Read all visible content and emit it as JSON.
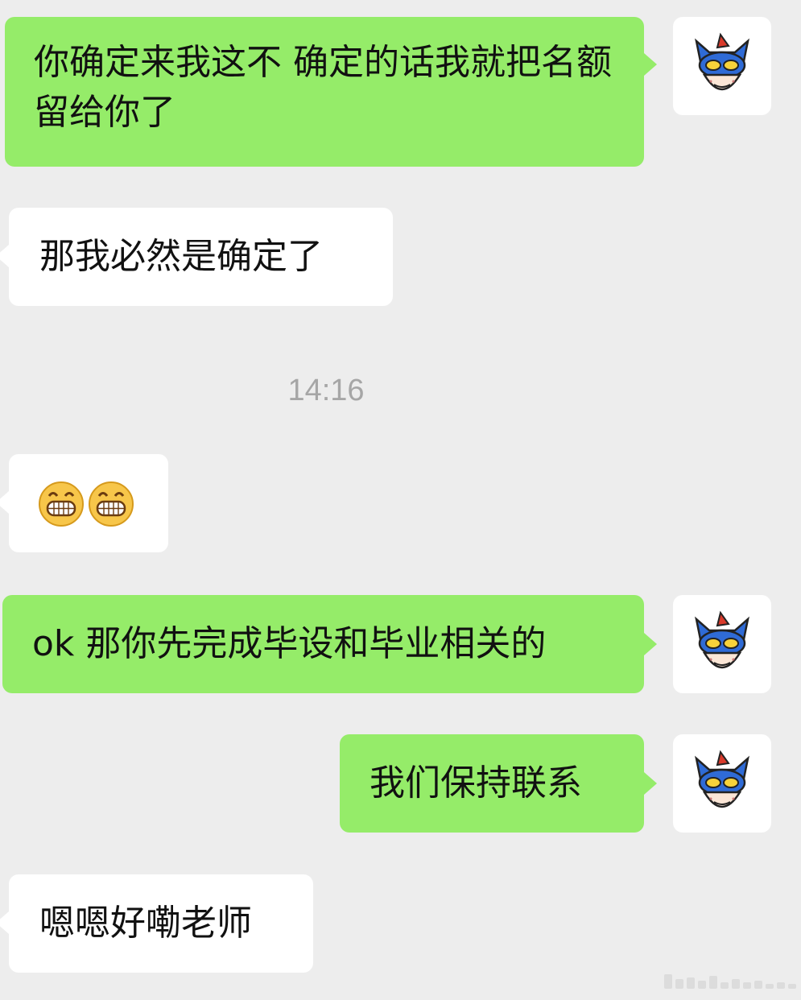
{
  "chat": {
    "messages": [
      {
        "side": "sent",
        "text": "你确定来我这不 确定的话我就把名额留给你了"
      },
      {
        "side": "received",
        "text": "那我必然是确定了"
      },
      {
        "side": "timestamp",
        "text": "14:16"
      },
      {
        "side": "received",
        "emoji": [
          "grinning-face-emoji",
          "grinning-face-emoji"
        ]
      },
      {
        "side": "sent",
        "text": "ok 那你先完成毕设和毕业相关的"
      },
      {
        "side": "sent",
        "text": "我们保持联系"
      },
      {
        "side": "received",
        "text": "嗯嗯好嘞老师"
      }
    ]
  },
  "avatar_icon": "masked-hero-avatar-icon",
  "colors": {
    "background": "#ededed",
    "sent_bubble": "#95ec69",
    "received_bubble": "#ffffff",
    "timestamp_text": "#a6a6a6"
  }
}
